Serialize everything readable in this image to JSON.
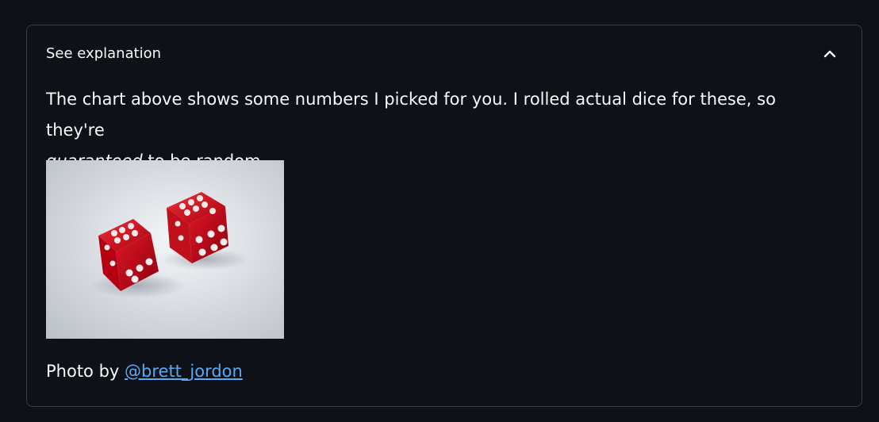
{
  "expander": {
    "title": "See explanation",
    "expanded": true,
    "toggle_icon": "chevron-up-icon"
  },
  "content": {
    "line1": "The chart above shows some numbers I picked for you. I rolled actual dice for these, so they're",
    "line2_emphasis": "guaranteed",
    "line2_rest": " to be random.",
    "image_subject": "two red translucent dice on white background",
    "credit_prefix": "Photo by ",
    "credit_link": "@brett_jordon"
  },
  "colors": {
    "background": "#0e1117",
    "border": "#3a3d46",
    "text": "#fafafa",
    "link": "#5aa9f5",
    "dice": "#d0101c"
  }
}
